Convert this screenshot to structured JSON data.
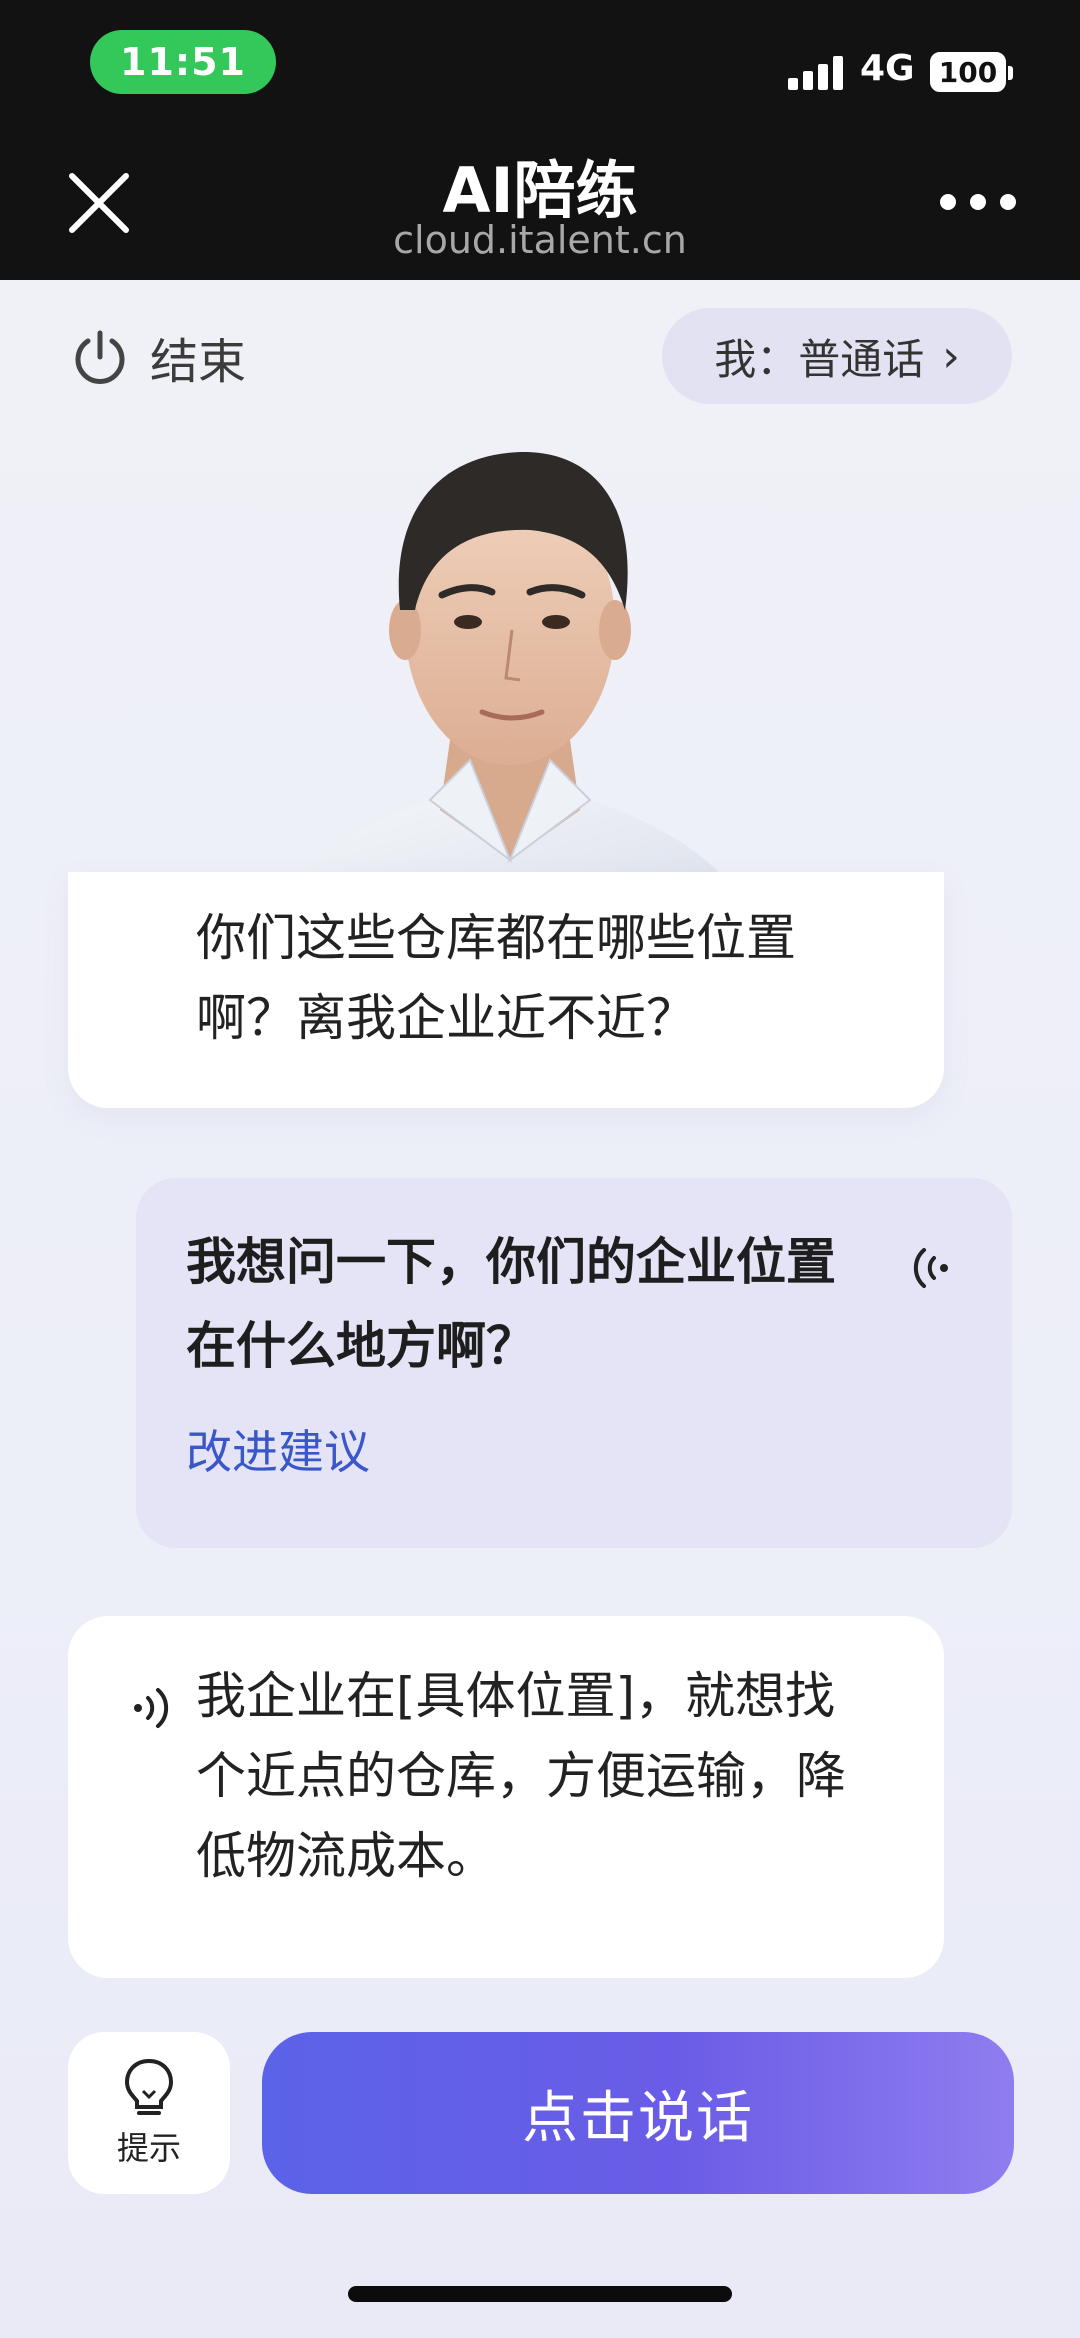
{
  "status_bar": {
    "time": "11:51",
    "network": "4G",
    "battery": "100"
  },
  "nav": {
    "title": "AI陪练",
    "subtitle": "cloud.italent.cn"
  },
  "controls": {
    "end_label": "结束",
    "language_label": "我：普通话"
  },
  "chat": {
    "ai_message_1": "你们这些仓库都在哪些位置啊？离我企业近不近？",
    "user_message": "我想问一下，你们的企业位置在什么地方啊？",
    "suggestion_link": "改进建议",
    "ai_message_2": "我企业在[具体位置]，就想找个近点的仓库，方便运输，降低物流成本。"
  },
  "bottom": {
    "hint_label": "提示",
    "talk_label": "点击说话"
  },
  "icons": [
    "close-icon",
    "more-icon",
    "power-icon",
    "chevron-right-icon",
    "voice-wave-icon",
    "lightbulb-icon"
  ],
  "colors": {
    "accent": "#5b63e8",
    "link": "#3a57c8",
    "user_bubble": "#e4e4f6"
  }
}
